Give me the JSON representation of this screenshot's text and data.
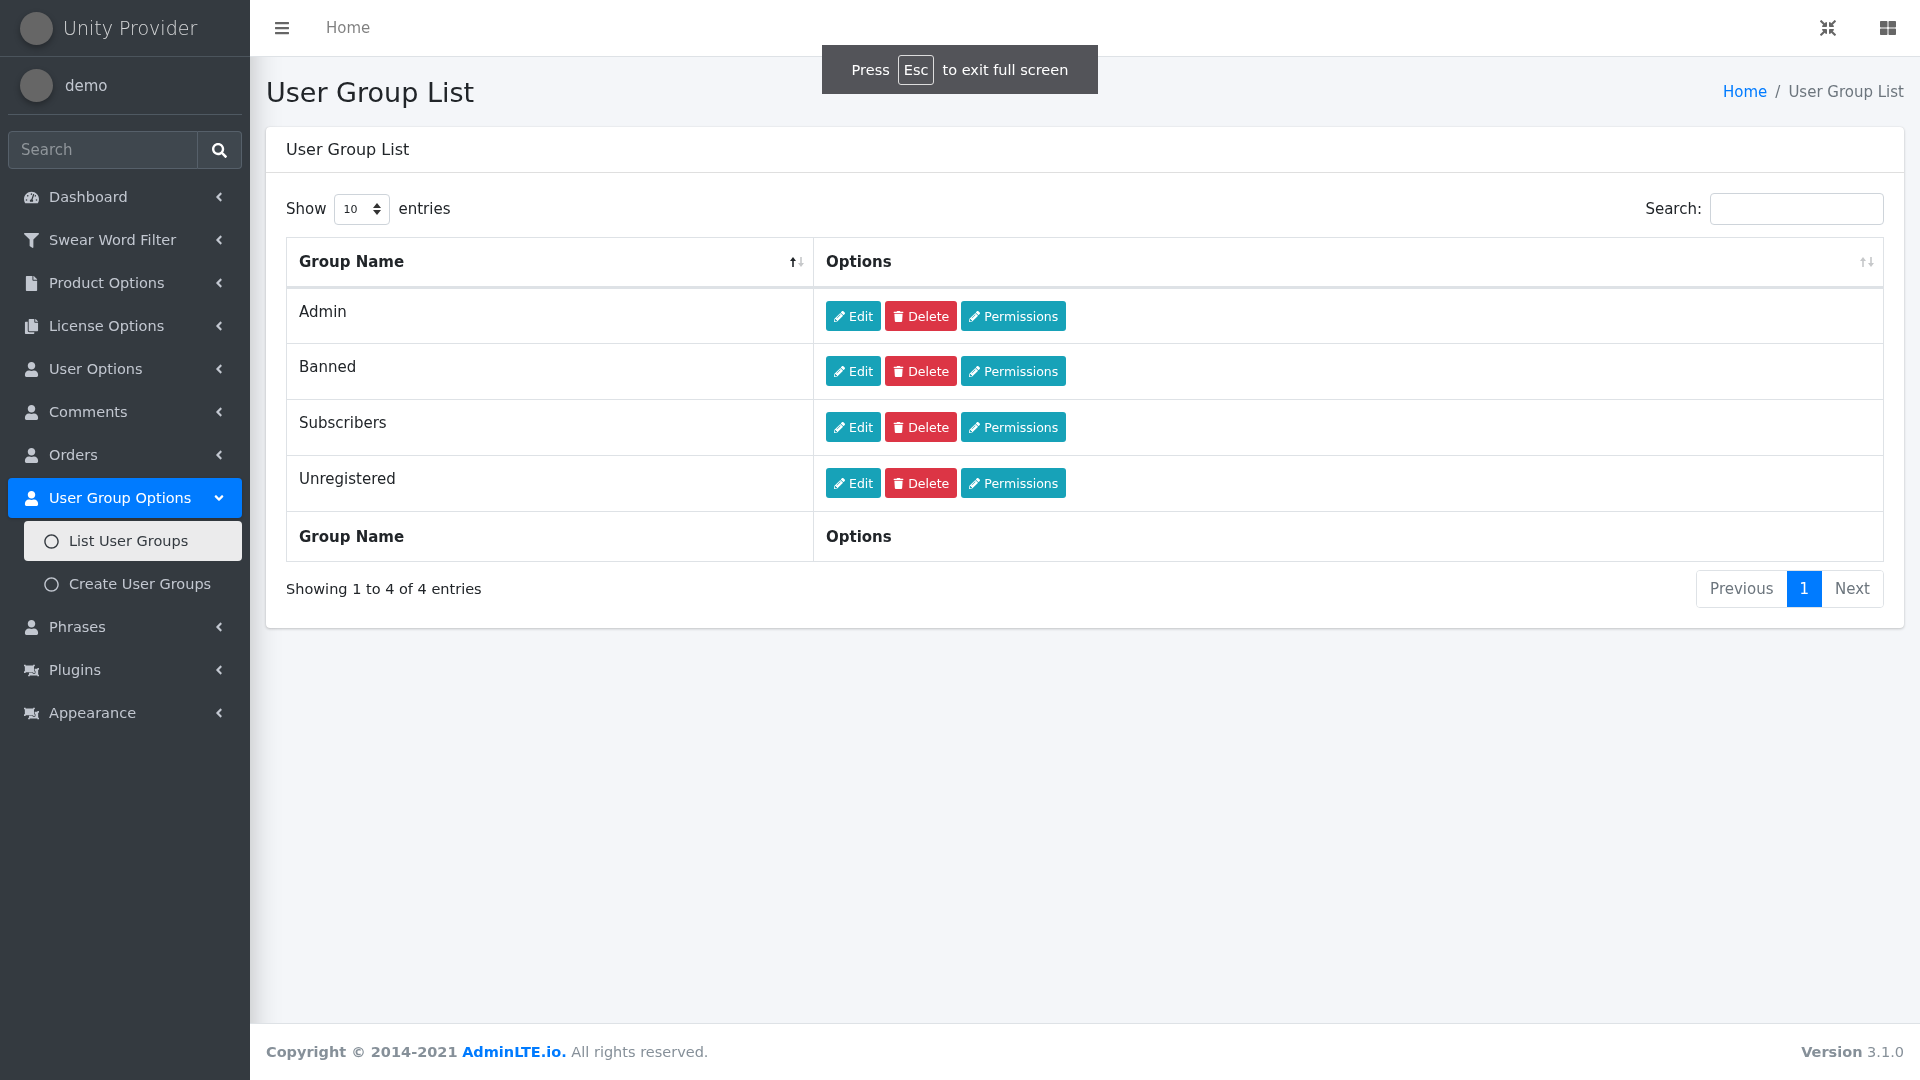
{
  "brand": {
    "name": "Unity Provider"
  },
  "user": {
    "name": "demo"
  },
  "sidebar_search": {
    "placeholder": "Search"
  },
  "sidebar": {
    "items": [
      {
        "label": "Dashboard",
        "expanded": false,
        "selected": false
      },
      {
        "label": "Swear Word Filter",
        "expanded": false,
        "selected": false
      },
      {
        "label": "Product Options",
        "expanded": false,
        "selected": false
      },
      {
        "label": "License Options",
        "expanded": false,
        "selected": false
      },
      {
        "label": "User Options",
        "expanded": false,
        "selected": false
      },
      {
        "label": "Comments",
        "expanded": false,
        "selected": false
      },
      {
        "label": "Orders",
        "expanded": false,
        "selected": false
      },
      {
        "label": "User Group Options",
        "expanded": true,
        "selected": true,
        "children": [
          {
            "label": "List User Groups",
            "selected": true
          },
          {
            "label": "Create User Groups",
            "selected": false
          }
        ]
      },
      {
        "label": "Phrases",
        "expanded": false,
        "selected": false
      },
      {
        "label": "Plugins",
        "expanded": false,
        "selected": false
      },
      {
        "label": "Appearance",
        "expanded": false,
        "selected": false
      }
    ]
  },
  "topbar": {
    "links": [
      "Home"
    ]
  },
  "fullscreen_notice": {
    "before": "Press",
    "key": "Esc",
    "after": "to exit full screen"
  },
  "page": {
    "title": "User Group List",
    "separator": "/",
    "breadcrumb": [
      {
        "label": "Home",
        "link": true
      },
      {
        "label": "User Group List",
        "link": false
      }
    ]
  },
  "card": {
    "title": "User Group List",
    "length": {
      "before": "Show",
      "value": "10",
      "after": "entries"
    },
    "search": {
      "label": "Search:"
    },
    "table": {
      "columns": [
        {
          "label": "Group Name",
          "sorted": true
        },
        {
          "label": "Options",
          "sorted": false
        }
      ],
      "rows": [
        {
          "name": "Admin",
          "actions": [
            {
              "kind": "edit",
              "label": "Edit"
            },
            {
              "kind": "delete",
              "label": "Delete"
            },
            {
              "kind": "edit",
              "label": "Permissions"
            }
          ]
        },
        {
          "name": "Banned",
          "actions": [
            {
              "kind": "edit",
              "label": "Edit"
            },
            {
              "kind": "delete",
              "label": "Delete"
            },
            {
              "kind": "edit",
              "label": "Permissions"
            }
          ]
        },
        {
          "name": "Subscribers",
          "actions": [
            {
              "kind": "edit",
              "label": "Edit"
            },
            {
              "kind": "delete",
              "label": "Delete"
            },
            {
              "kind": "edit",
              "label": "Permissions"
            }
          ]
        },
        {
          "name": "Unregistered",
          "actions": [
            {
              "kind": "edit",
              "label": "Edit"
            },
            {
              "kind": "delete",
              "label": "Delete"
            },
            {
              "kind": "edit",
              "label": "Permissions"
            }
          ]
        }
      ],
      "footer": [
        "Group Name",
        "Options"
      ]
    },
    "info": "Showing 1 to 4 of 4 entries",
    "pagination": [
      {
        "label": "Previous",
        "selected": false
      },
      {
        "label": "1",
        "selected": true
      },
      {
        "label": "Next",
        "selected": false
      }
    ]
  },
  "footer": {
    "copyright": "Copyright © 2014-2021",
    "link": "AdminLTE.io.",
    "rest": "All rights reserved.",
    "version": "**Version** 3.1.0"
  }
}
